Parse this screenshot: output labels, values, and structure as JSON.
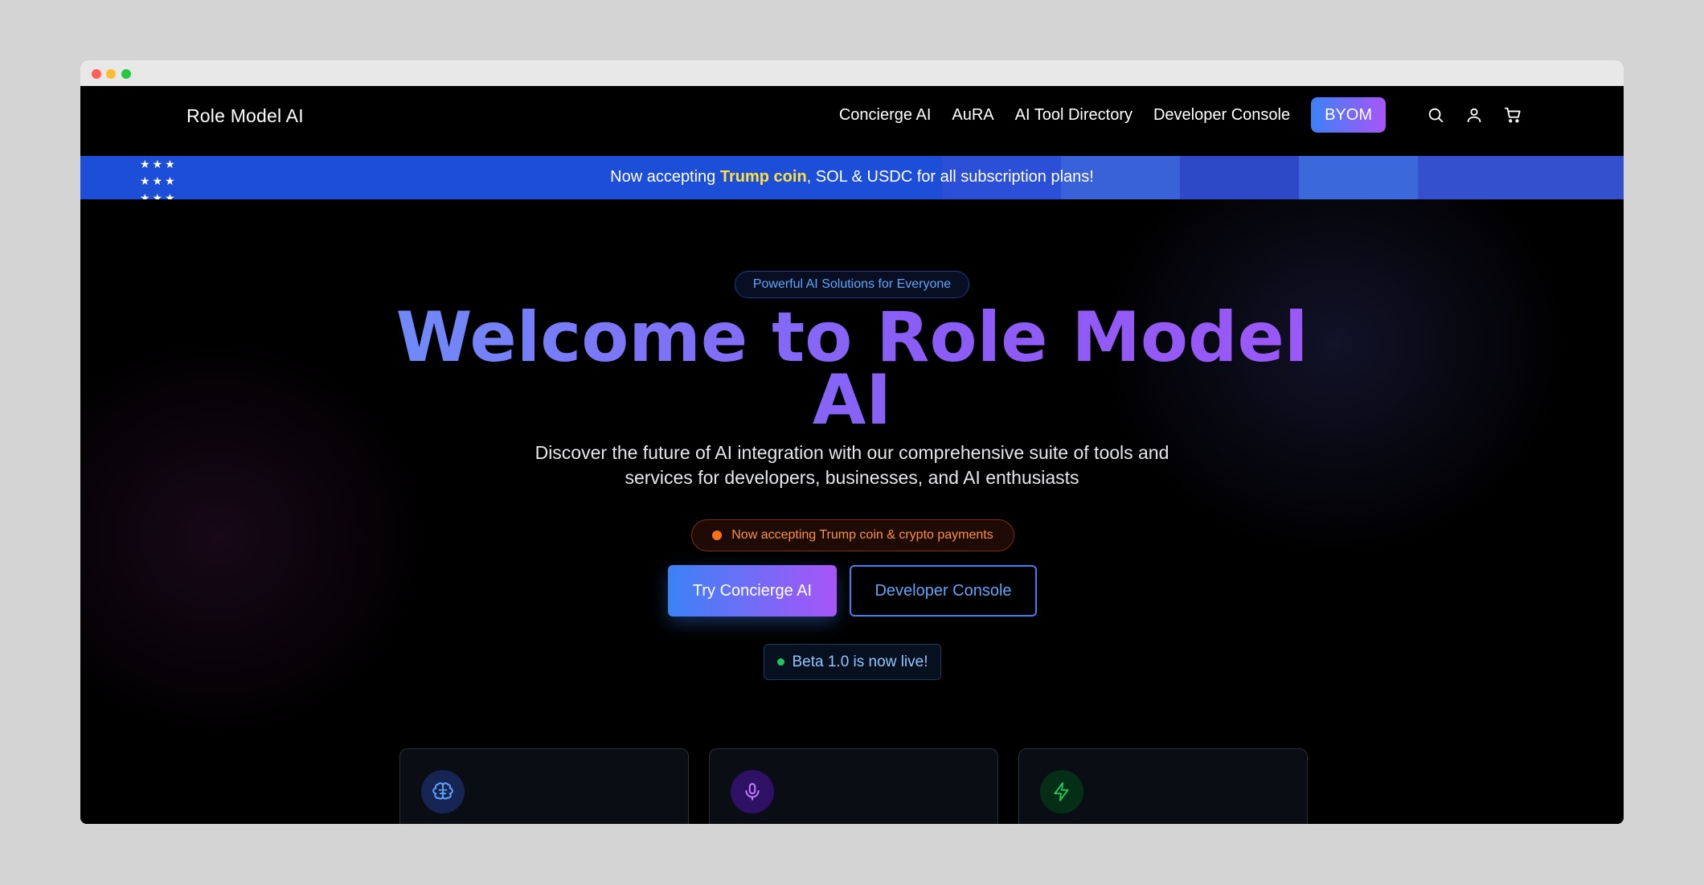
{
  "brand": {
    "name": "Role Model AI"
  },
  "nav": {
    "links": [
      "Concierge AI",
      "AuRA",
      "AI Tool Directory",
      "Developer Console"
    ],
    "cta": "BYOM",
    "icons": [
      "search-icon",
      "user-icon",
      "cart-icon"
    ]
  },
  "banner": {
    "stars": "★★★",
    "prefix": "Now accepting ",
    "highlight": "Trump coin",
    "suffix": ", SOL & USDC for all subscription plans!"
  },
  "hero": {
    "tagline": "Powerful AI Solutions for Everyone",
    "title_line1": "Welcome to Role Model",
    "title_line2": "AI",
    "subtitle_line1": "Discover the future of AI integration with our comprehensive suite of tools and",
    "subtitle_line2": "services for developers, businesses, and AI enthusiasts",
    "crypto_badge": "Now accepting Trump coin & crypto payments",
    "primary_button": "Try Concierge AI",
    "secondary_button": "Developer Console",
    "beta_badge": "Beta 1.0 is now live!"
  },
  "feature_cards": [
    {
      "icon": "brain-icon"
    },
    {
      "icon": "microphone-icon"
    },
    {
      "icon": "lightning-icon"
    }
  ],
  "colors": {
    "accent_blue": "#3b82f6",
    "accent_purple": "#a855f7",
    "banner_blue": "#1d4ed8",
    "highlight_yellow": "#fde047",
    "orange": "#f97316",
    "green": "#22c55e"
  }
}
